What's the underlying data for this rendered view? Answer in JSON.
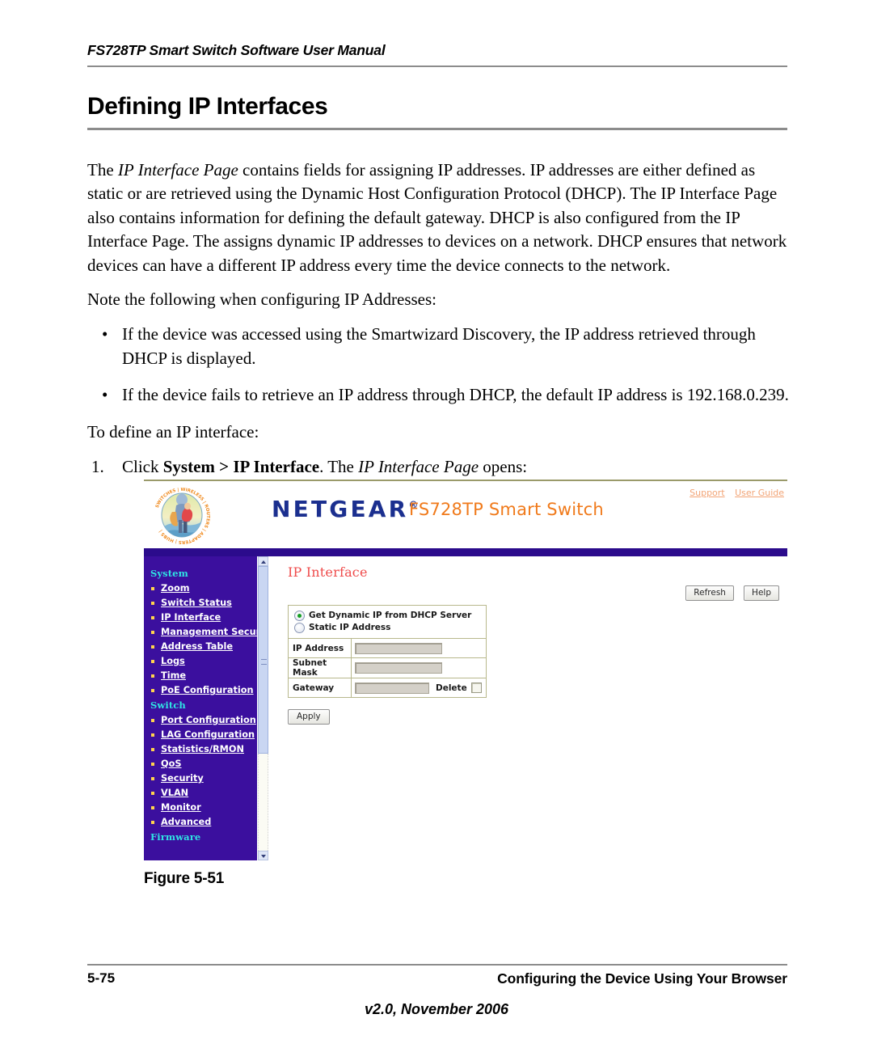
{
  "header": {
    "running_head": "FS728TP Smart Switch Software User Manual",
    "chapter_title": "Defining IP Interfaces"
  },
  "body": {
    "intro_p1_a": "The ",
    "intro_p1_em": "IP Interface Page",
    "intro_p1_b": " contains fields for assigning IP addresses. IP addresses are either defined as static or are retrieved using the Dynamic Host Configuration Protocol (DHCP). The IP Interface Page also contains information for defining the default gateway. DHCP is also configured from the IP Interface Page. The assigns dynamic IP addresses to devices on a network. DHCP ensures that network devices can have a different IP address every time the device connects to the network.",
    "note_line": "Note the following when configuring IP Addresses:",
    "bullet_char": "•",
    "bullets": [
      "If the device was accessed using the Smartwizard Discovery, the IP address retrieved through DHCP is displayed.",
      "If the device fails to retrieve an IP address through DHCP, the default IP address is 192.168.0.239."
    ],
    "to_define_line": "To define an IP interface:",
    "step_number": "1.",
    "step_a": "Click ",
    "step_bold": "System > IP Interface",
    "step_b": ". The ",
    "step_em": "IP Interface Page",
    "step_c": " opens:"
  },
  "screenshot": {
    "brand": {
      "wordmark": "NETGEAR",
      "trademark": "®",
      "model": "FS728TP Smart Switch",
      "logo_ring_text": "SWITCHES | WIRELESS | ROUTERS | ADAPTERS | HUBS"
    },
    "top_links": [
      {
        "label": "Support"
      },
      {
        "label": "User Guide"
      }
    ],
    "sidebar": [
      {
        "type": "group",
        "label": "System"
      },
      {
        "type": "link",
        "label": "Zoom"
      },
      {
        "type": "link",
        "label": "Switch Status"
      },
      {
        "type": "link",
        "label": "IP Interface"
      },
      {
        "type": "link",
        "label": "Management Security"
      },
      {
        "type": "link",
        "label": "Address Table"
      },
      {
        "type": "link",
        "label": "Logs"
      },
      {
        "type": "link",
        "label": "Time"
      },
      {
        "type": "link",
        "label": "PoE Configuration"
      },
      {
        "type": "group",
        "label": "Switch"
      },
      {
        "type": "link",
        "label": "Port Configuration"
      },
      {
        "type": "link",
        "label": "LAG Configuration"
      },
      {
        "type": "link",
        "label": "Statistics/RMON"
      },
      {
        "type": "link",
        "label": "QoS"
      },
      {
        "type": "link",
        "label": "Security"
      },
      {
        "type": "link",
        "label": "VLAN"
      },
      {
        "type": "link",
        "label": "Monitor"
      },
      {
        "type": "link",
        "label": "Advanced"
      },
      {
        "type": "group",
        "label": "Firmware"
      }
    ],
    "panel": {
      "title": "IP Interface",
      "refresh_label": "Refresh",
      "help_label": "Help",
      "radio_dhcp": "Get Dynamic IP from DHCP Server",
      "radio_static": "Static IP Address",
      "row_ip_label": "IP Address",
      "row_ip_value": "",
      "row_subnet_label": "Subnet Mask",
      "row_subnet_value": "",
      "row_gateway_label": "Gateway",
      "row_gateway_value": "",
      "delete_label": "Delete",
      "apply_label": "Apply"
    },
    "colors": {
      "sidebar_bg": "#3b0f9e",
      "navy_band": "#2b0b8c",
      "group_text": "#2fe3e3",
      "panel_title": "#ef4b4b",
      "brand_blue": "#1b2f8f",
      "brand_orange": "#f07a1b",
      "link_orange": "#f2a476",
      "table_border": "#b8b88c",
      "input_bg": "#d4d0c8",
      "bullet_square": "#ffd34d"
    }
  },
  "figure": {
    "caption": "Figure 5-51"
  },
  "footer": {
    "page_number": "5-75",
    "section": "Configuring the Device Using Your Browser",
    "version": "v2.0, November 2006"
  }
}
